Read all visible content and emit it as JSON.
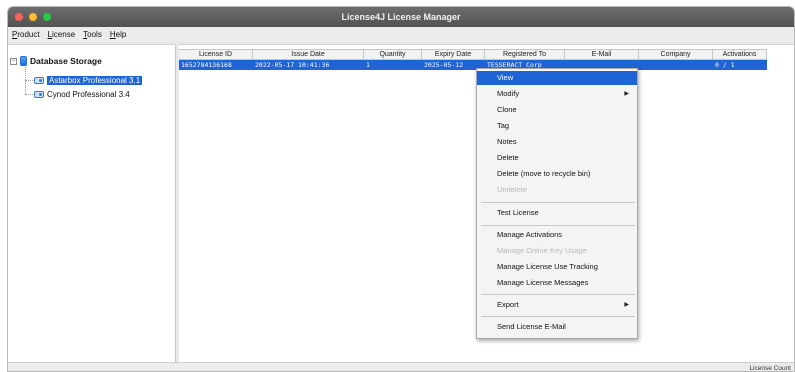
{
  "window": {
    "title": "License4J License Manager"
  },
  "menubar": [
    "Product",
    "License",
    "Tools",
    "Help"
  ],
  "tree": {
    "root": "Database Storage",
    "items": [
      "Astarbox Professional 3.1",
      "Cynod Professional 3.4"
    ]
  },
  "table": {
    "columns": [
      "License ID",
      "Issue Date",
      "Quantity",
      "Expiry Date",
      "Registered To",
      "E-Mail",
      "Company",
      "Activations"
    ],
    "rows": [
      [
        "1652784136168",
        "2022-05-17 10:41:36",
        "1",
        "2025-05-12",
        "TESSERACT Corp",
        "",
        "",
        "0 / 1"
      ]
    ]
  },
  "context_menu": {
    "items": [
      {
        "label": "View"
      },
      {
        "label": "Modify",
        "arrow": "▶"
      },
      {
        "label": "Clone"
      },
      {
        "label": "Tag"
      },
      {
        "label": "Notes"
      },
      {
        "label": "Delete"
      },
      {
        "label": "Delete (move to recycle bin)"
      },
      {
        "label": "Undelete"
      },
      {
        "label": "Test License"
      },
      {
        "label": "Manage Activations"
      },
      {
        "label": "Manage Online Key Usage"
      },
      {
        "label": "Manage License Use Tracking"
      },
      {
        "label": "Manage License Messages"
      },
      {
        "label": "Export",
        "arrow": "▶"
      },
      {
        "label": "Send License E-Mail"
      }
    ]
  },
  "statusbar": {
    "text": "License Count"
  },
  "colors": {
    "selection": "#1f64d6",
    "titlebar": "#5e5e5e",
    "disabled_text": "#b8b8b8"
  }
}
